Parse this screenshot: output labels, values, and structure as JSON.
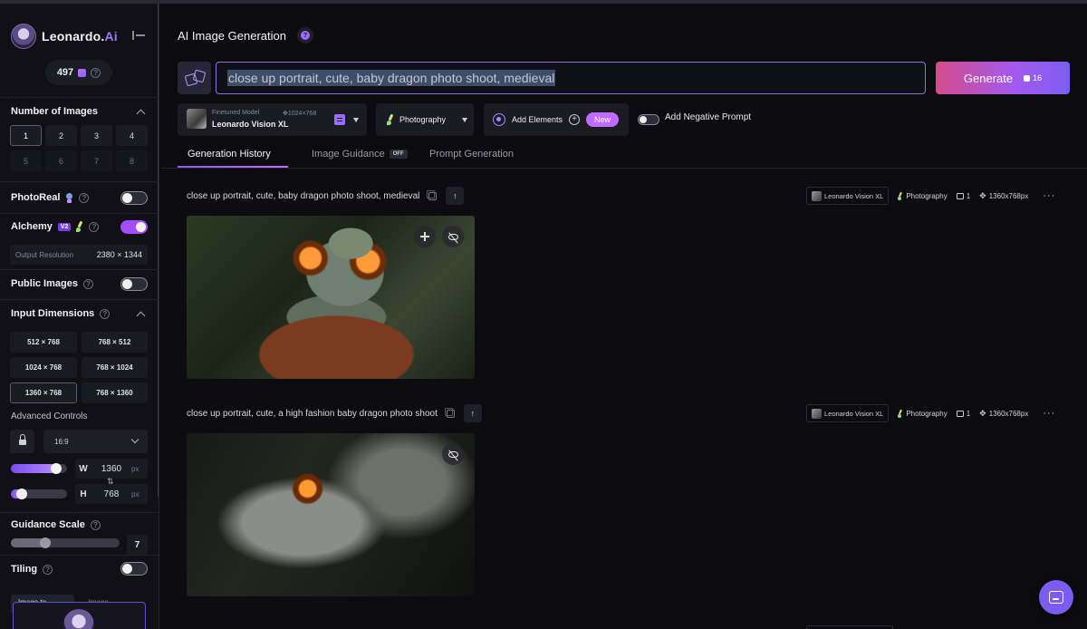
{
  "app": {
    "brand_prefix": "Leonardo.",
    "brand_suffix": "Ai",
    "token_count": "497"
  },
  "sidebar": {
    "number_of_images": {
      "title": "Number of Images",
      "options": [
        "1",
        "2",
        "3",
        "4",
        "5",
        "6",
        "7",
        "8"
      ],
      "selected": "1"
    },
    "photoreal": {
      "label": "PhotoReal",
      "on": false
    },
    "alchemy": {
      "label": "Alchemy",
      "badge": "V2",
      "on": true
    },
    "output_resolution": {
      "label": "Output Resolution",
      "value": "2380 × 1344"
    },
    "public_images": {
      "label": "Public Images",
      "on": false
    },
    "input_dimensions": {
      "title": "Input Dimensions",
      "options": [
        "512 × 768",
        "768 × 512",
        "1024 × 768",
        "768 × 1024",
        "1360 × 768",
        "768 × 1360"
      ],
      "selected": "1360 × 768"
    },
    "advanced_controls": {
      "label": "Advanced Controls",
      "aspect_ratio": "16:9",
      "width_key": "W",
      "width": "1360",
      "height_key": "H",
      "height": "768",
      "unit": "px",
      "width_fraction": 0.8,
      "height_fraction": 0.2
    },
    "guidance_scale": {
      "label": "Guidance Scale",
      "value": "7"
    },
    "tiling": {
      "label": "Tiling",
      "on": false
    },
    "bottom_tabs": [
      "Image to Image",
      "Image Prompt"
    ]
  },
  "main": {
    "title": "AI Image Generation",
    "prompt": "close up portrait, cute, baby dragon photo shoot, medieval",
    "generate": {
      "label": "Generate",
      "cost": "16"
    },
    "model": {
      "sublabel": "Finetuned Model",
      "dims": "1024×768",
      "name": "Leonardo Vision XL"
    },
    "style": "Photography",
    "add_elements": {
      "label": "Add Elements",
      "badge": "New"
    },
    "negative_prompt": {
      "label": "Add Negative Prompt",
      "on": false
    },
    "tabs": [
      {
        "label": "Generation History",
        "active": true
      },
      {
        "label": "Image Guidance",
        "badge": "OFF"
      },
      {
        "label": "Prompt Generation"
      }
    ],
    "generations": [
      {
        "prompt": "close up portrait, cute, baby dragon photo shoot, medieval",
        "model": "Leonardo Vision XL",
        "style": "Photography",
        "count": "1",
        "size": "1360x768px"
      },
      {
        "prompt": "close up portrait, cute, a high fashion baby dragon photo shoot",
        "model": "Leonardo Vision XL",
        "style": "Photography",
        "count": "1",
        "size": "1360x768px"
      }
    ]
  }
}
